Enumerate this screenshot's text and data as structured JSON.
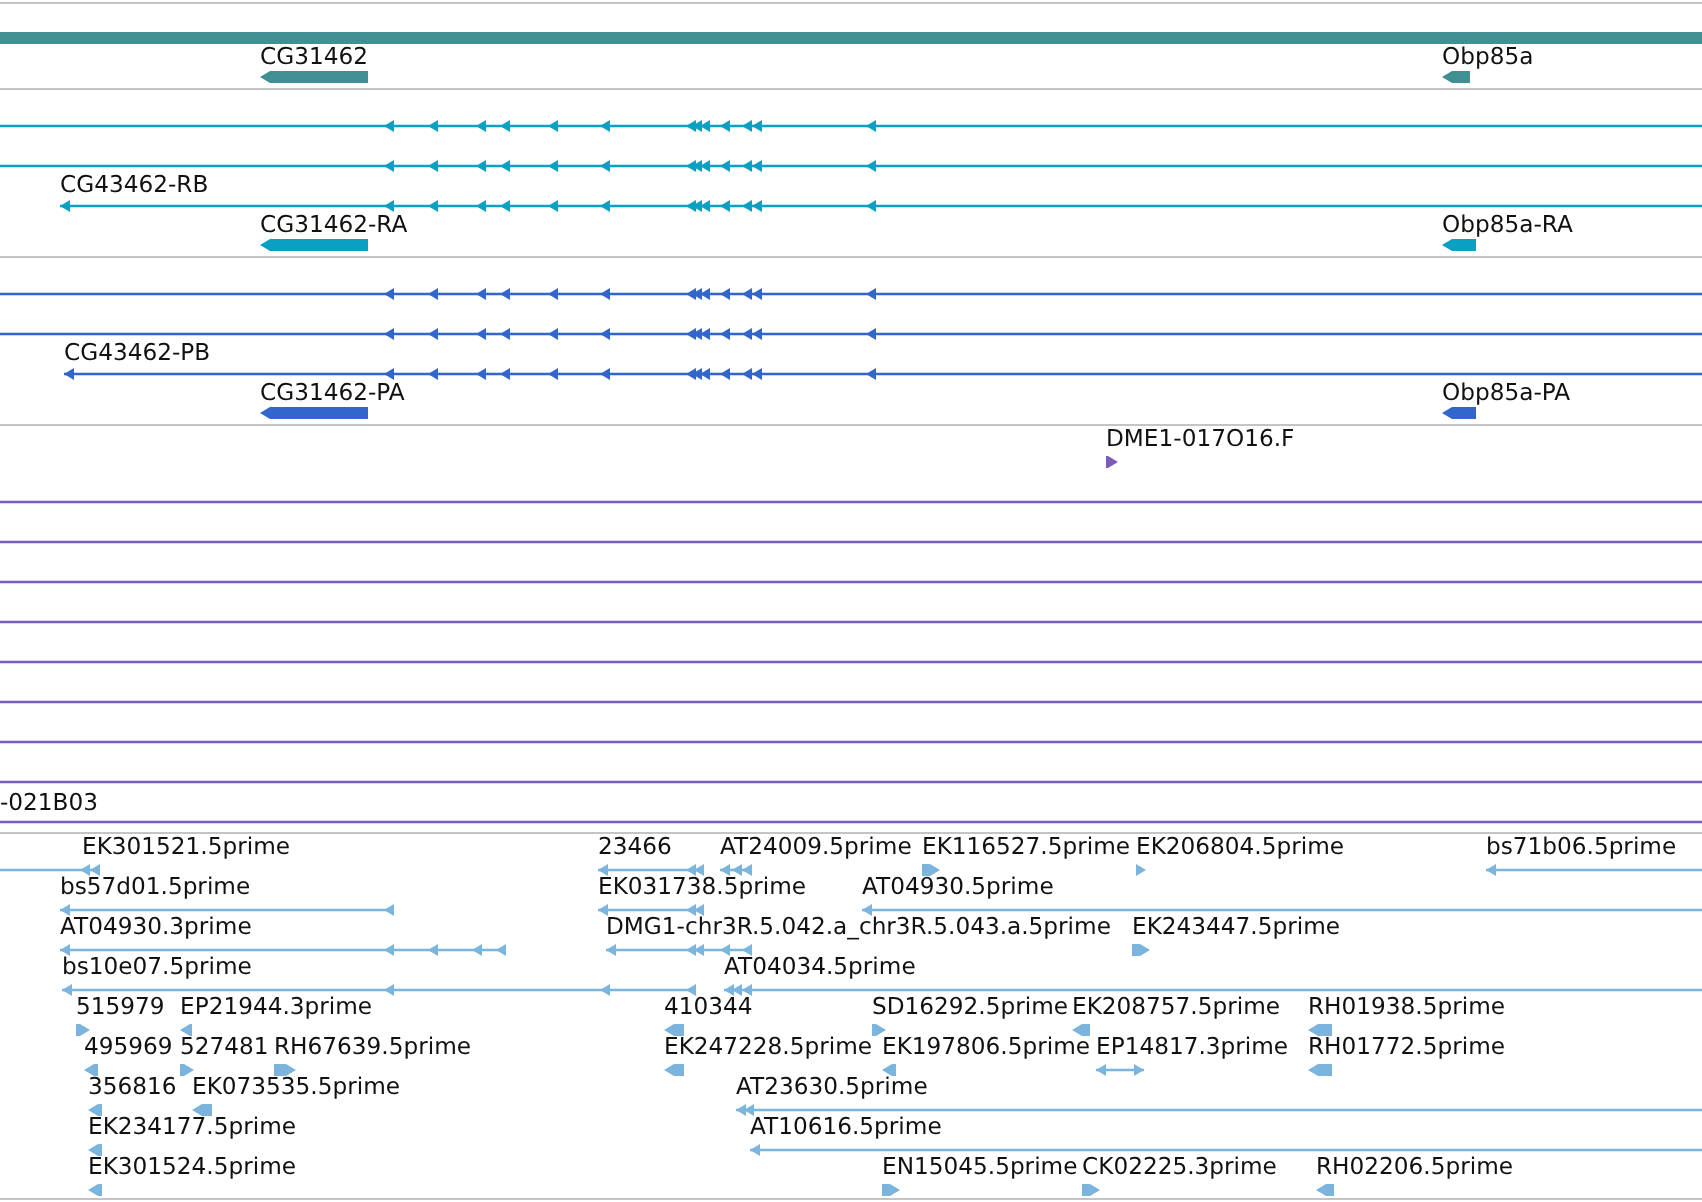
{
  "tracks": [
    {
      "color": "#3f8f93",
      "features": [
        {
          "label": "CG31462"
        },
        {
          "label": "Obp85a"
        }
      ]
    },
    {
      "color": "#0aa0c4",
      "features": [
        {
          "label": "CG43462-RB"
        },
        {
          "label": "CG31462-RA"
        },
        {
          "label": "Obp85a-RA"
        }
      ]
    },
    {
      "color": "#3366cc",
      "features": [
        {
          "label": "CG43462-PB"
        },
        {
          "label": "CG31462-PA"
        },
        {
          "label": "Obp85a-PA"
        }
      ]
    },
    {
      "color": "#7a5cc0",
      "features": [
        {
          "label": "DME1-017O16.F"
        },
        {
          "label": "-021B03"
        }
      ]
    },
    {
      "color": "#7bb4dc",
      "features": [
        {
          "label": "EK301521.5prime"
        },
        {
          "label": "23466"
        },
        {
          "label": "AT24009.5prime"
        },
        {
          "label": "EK116527.5prime"
        },
        {
          "label": "EK206804.5prime"
        },
        {
          "label": "bs71b06.5prime"
        },
        {
          "label": "bs57d01.5prime"
        },
        {
          "label": "EK031738.5prime"
        },
        {
          "label": "AT04930.5prime"
        },
        {
          "label": "AT04930.3prime"
        },
        {
          "label": "DMG1-chr3R.5.042.a_chr3R.5.043.a.5prime"
        },
        {
          "label": "EK243447.5prime"
        },
        {
          "label": "bs10e07.5prime"
        },
        {
          "label": "AT04034.5prime"
        },
        {
          "label": "515979"
        },
        {
          "label": "EP21944.3prime"
        },
        {
          "label": "410344"
        },
        {
          "label": "SD16292.5prime"
        },
        {
          "label": "EK208757.5prime"
        },
        {
          "label": "RH01938.5prime"
        },
        {
          "label": "495969"
        },
        {
          "label": "527481"
        },
        {
          "label": "RH67639.5prime"
        },
        {
          "label": "EK247228.5prime"
        },
        {
          "label": "EK197806.5prime"
        },
        {
          "label": "EP14817.3prime"
        },
        {
          "label": "RH01772.5prime"
        },
        {
          "label": "356816"
        },
        {
          "label": "EK073535.5prime"
        },
        {
          "label": "AT23630.5prime"
        },
        {
          "label": "EK234177.5prime"
        },
        {
          "label": "AT10616.5prime"
        },
        {
          "label": "EK301524.5prime"
        },
        {
          "label": "EN15045.5prime"
        },
        {
          "label": "CK02225.3prime"
        },
        {
          "label": "RH02206.5prime"
        }
      ]
    }
  ]
}
